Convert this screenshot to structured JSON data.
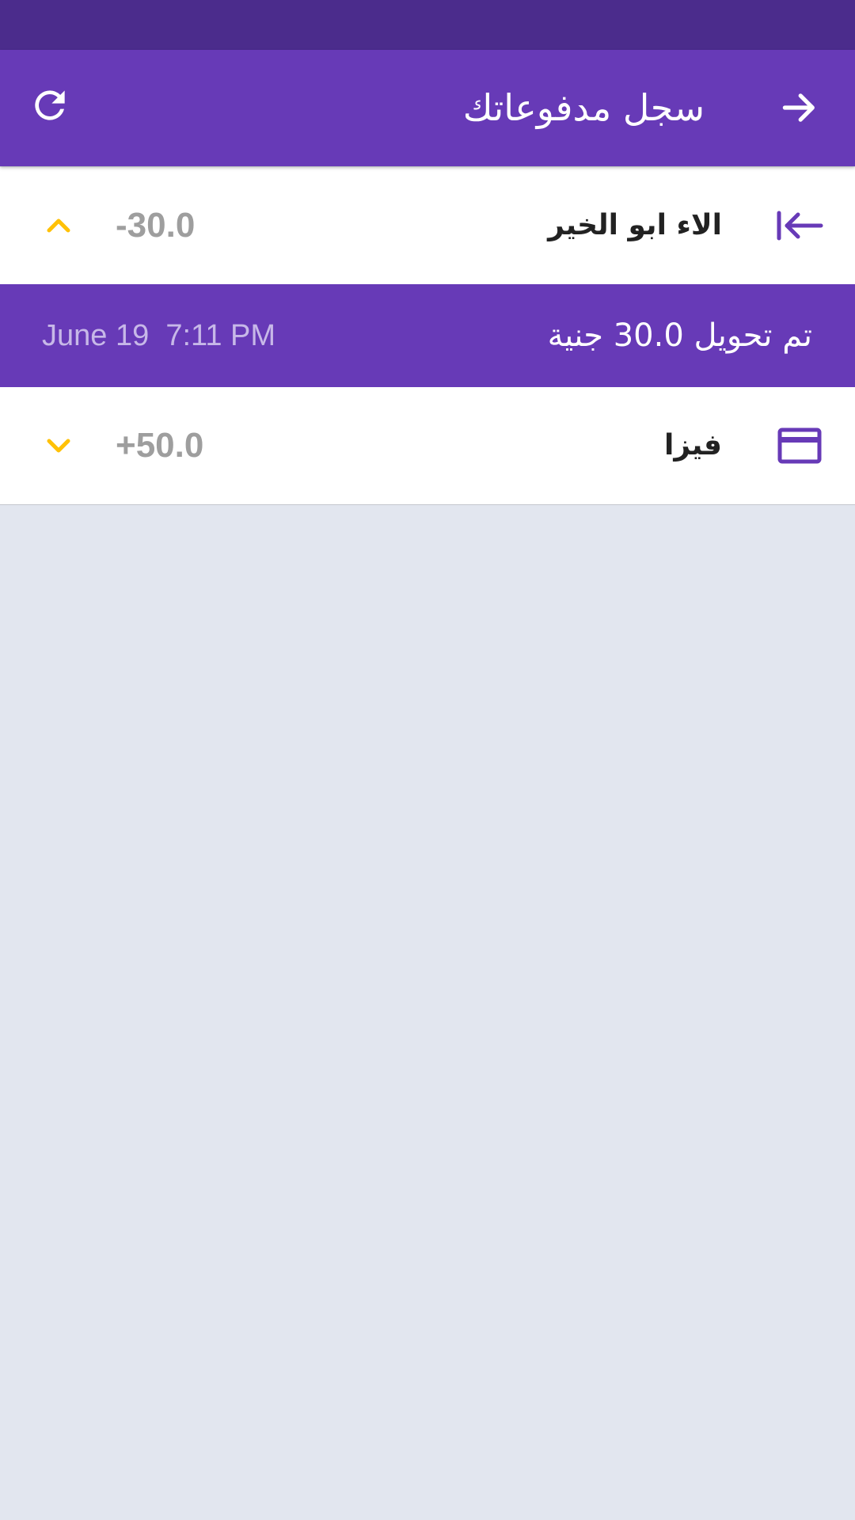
{
  "app_bar": {
    "title": "سجل مدفوعاتك",
    "back_icon": "arrow-right-icon",
    "refresh_icon": "refresh-icon"
  },
  "colors": {
    "primary": "#673AB7",
    "status_bar": "#4B2C8C",
    "accent": "#FFC107",
    "background": "#E2E6EF"
  },
  "transactions": [
    {
      "name": "الاء ابو الخير",
      "amount": "-30.0",
      "icon": "transfer-out-icon",
      "chevron": "chevron-up-icon",
      "expanded": true,
      "detail": {
        "text": "تم تحويل 30.0 جنية",
        "timestamp": "June 19  7:11 PM"
      }
    },
    {
      "name": "فيزا",
      "amount": "+50.0",
      "icon": "credit-card-icon",
      "chevron": "chevron-down-icon",
      "expanded": false
    }
  ]
}
